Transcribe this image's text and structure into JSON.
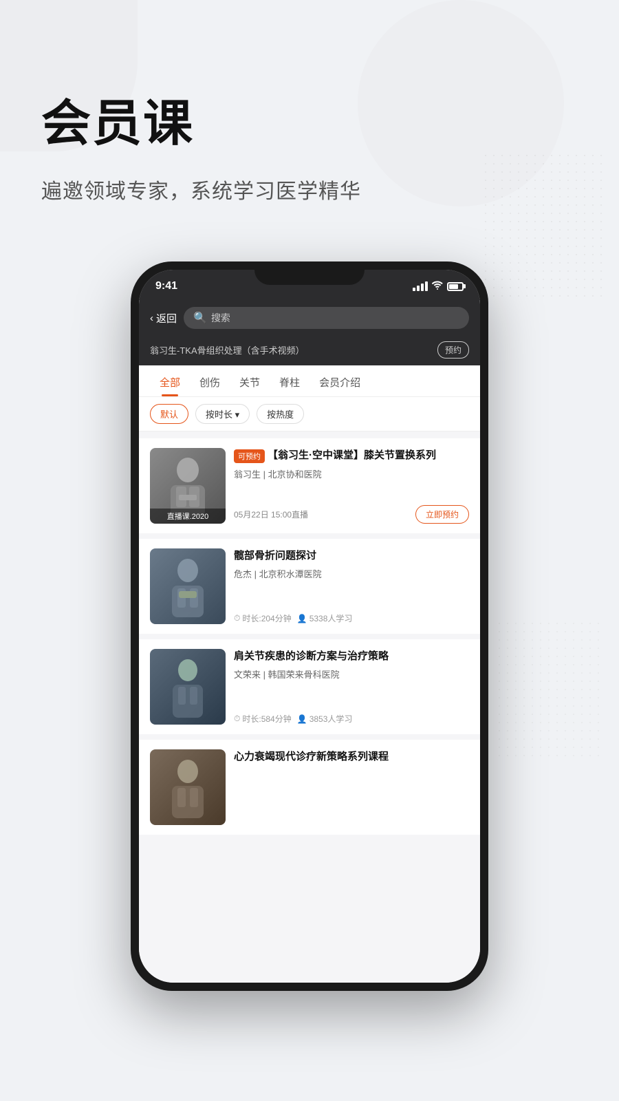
{
  "page": {
    "background": "#f0f2f5"
  },
  "header": {
    "title": "会员课",
    "subtitle": "遍邀领域专家，系统学习医学精华"
  },
  "phone": {
    "status_bar": {
      "time": "9:41"
    },
    "nav": {
      "back_label": "返回",
      "search_placeholder": "搜索"
    },
    "banner": {
      "text": "翁习生-TKA骨组织处理（含手术视频）",
      "btn_label": "预约"
    },
    "tabs": [
      {
        "label": "全部",
        "active": true
      },
      {
        "label": "创伤",
        "active": false
      },
      {
        "label": "关节",
        "active": false
      },
      {
        "label": "脊柱",
        "active": false
      },
      {
        "label": "会员介绍",
        "active": false
      }
    ],
    "filters": [
      {
        "label": "默认",
        "active": true
      },
      {
        "label": "按时长 ▾",
        "active": false
      },
      {
        "label": "按热度",
        "active": false
      }
    ],
    "courses": [
      {
        "id": 1,
        "badge": "可预约",
        "title": "【翁习生·空中课堂】膝关节置换系列",
        "author": "翁习生 | 北京协和医院",
        "date": "05月22日 15:00直播",
        "action_label": "立即预约",
        "thumb_label": "直播课.2020",
        "thumb_type": "person1",
        "duration": null,
        "students": null
      },
      {
        "id": 2,
        "badge": null,
        "title": "髋部骨折问题探讨",
        "author": "危杰 | 北京积水潭医院",
        "date": null,
        "action_label": null,
        "thumb_label": null,
        "thumb_type": "person2",
        "duration": "时长:204分钟",
        "students": "5338人学习"
      },
      {
        "id": 3,
        "badge": null,
        "title": "肩关节疾患的诊断方案与治疗策略",
        "author": "文荣来 | 韩国荣来骨科医院",
        "date": null,
        "action_label": null,
        "thumb_label": null,
        "thumb_type": "person3",
        "duration": "时长:584分钟",
        "students": "3853人学习"
      },
      {
        "id": 4,
        "badge": null,
        "title": "心力衰竭现代诊疗新策略系列课程",
        "author": "",
        "date": null,
        "action_label": null,
        "thumb_label": null,
        "thumb_type": "person4",
        "duration": null,
        "students": null
      }
    ]
  }
}
